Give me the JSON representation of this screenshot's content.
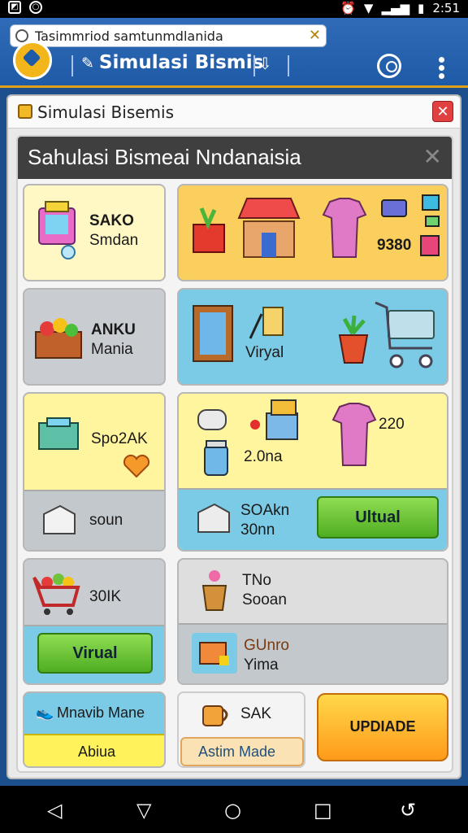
{
  "status": {
    "time": "2:51"
  },
  "browser": {
    "url": "Tasimmriod samtunmdlanida"
  },
  "app": {
    "title": "Simulasi Bismis"
  },
  "dialog": {
    "title": "Simulasi Bisemis"
  },
  "panel": {
    "title": "Sahulasi Bismeai Nndanaisia",
    "tiles": {
      "saku_line1": "SAKO",
      "saku_line2": "Smdan",
      "stall_price": "9380",
      "anku_line1": "ANKU",
      "anku_line2": "Mania",
      "viryal": "Viryal",
      "spo2ak": "Spo2AK",
      "soun": "soun",
      "clothes_price": "220",
      "jar_price": "2.0na",
      "soakn_line1": "SOAkn",
      "soakn_line2": "30nn",
      "virtual_btn_1": "Ultual",
      "cart_price": "30IK",
      "tno_line1": "TNo",
      "tno_line2": "Sooan",
      "virtual_btn_2": "Virual",
      "gunro_line1": "GUnro",
      "gunro_line2": "Yima",
      "mnavib": "Mnavib Mane",
      "sak": "SAK",
      "abiua": "Abiua",
      "astim": "Astim Made",
      "update_btn": "UPDIADE"
    }
  }
}
